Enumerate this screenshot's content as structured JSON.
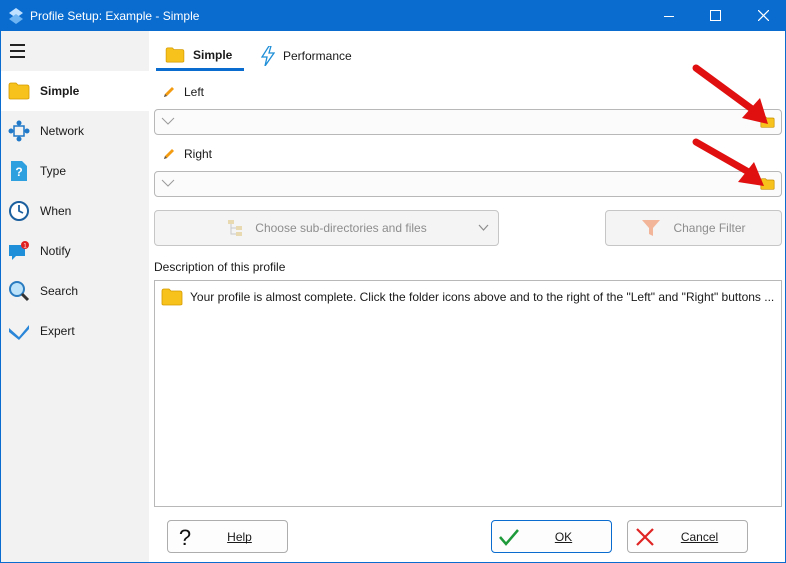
{
  "window": {
    "title": "Profile Setup: Example - Simple",
    "app_icon": "freefilesync-icon",
    "controls": [
      "minimize-icon",
      "maximize-icon",
      "close-icon"
    ]
  },
  "sidebar": {
    "menu_icon": "hamburger-icon",
    "items": [
      {
        "label": "Simple",
        "icon": "folder-icon",
        "active": true
      },
      {
        "label": "Network",
        "icon": "network-icon",
        "active": false
      },
      {
        "label": "Type",
        "icon": "help-page-icon",
        "active": false
      },
      {
        "label": "When",
        "icon": "clock-icon",
        "active": false
      },
      {
        "label": "Notify",
        "icon": "chat-notification-icon",
        "badge": "1",
        "active": false
      },
      {
        "label": "Search",
        "icon": "magnifier-icon",
        "active": false
      },
      {
        "label": "Expert",
        "icon": "chevron-check-icon",
        "active": false
      }
    ]
  },
  "tabs": [
    {
      "label": "Simple",
      "icon": "folder-icon",
      "active": true
    },
    {
      "label": "Performance",
      "icon": "lightning-icon",
      "active": false
    }
  ],
  "left_field": {
    "label": "Left",
    "value": ""
  },
  "right_field": {
    "label": "Right",
    "value": ""
  },
  "choose_button": {
    "label": "Choose sub-directories and files",
    "enabled": false
  },
  "filter_button": {
    "label": "Change Filter",
    "enabled": false
  },
  "description": {
    "label": "Description of this profile",
    "text": "Your profile is almost complete. Click the folder icons above and to the right of the \"Left\" and \"Right\" buttons ..."
  },
  "buttons": {
    "help": "Help",
    "ok": "OK",
    "cancel": "Cancel"
  },
  "colors": {
    "accent": "#0a6ccf",
    "folder": "#f7c21b",
    "arrow": "#e01010"
  }
}
